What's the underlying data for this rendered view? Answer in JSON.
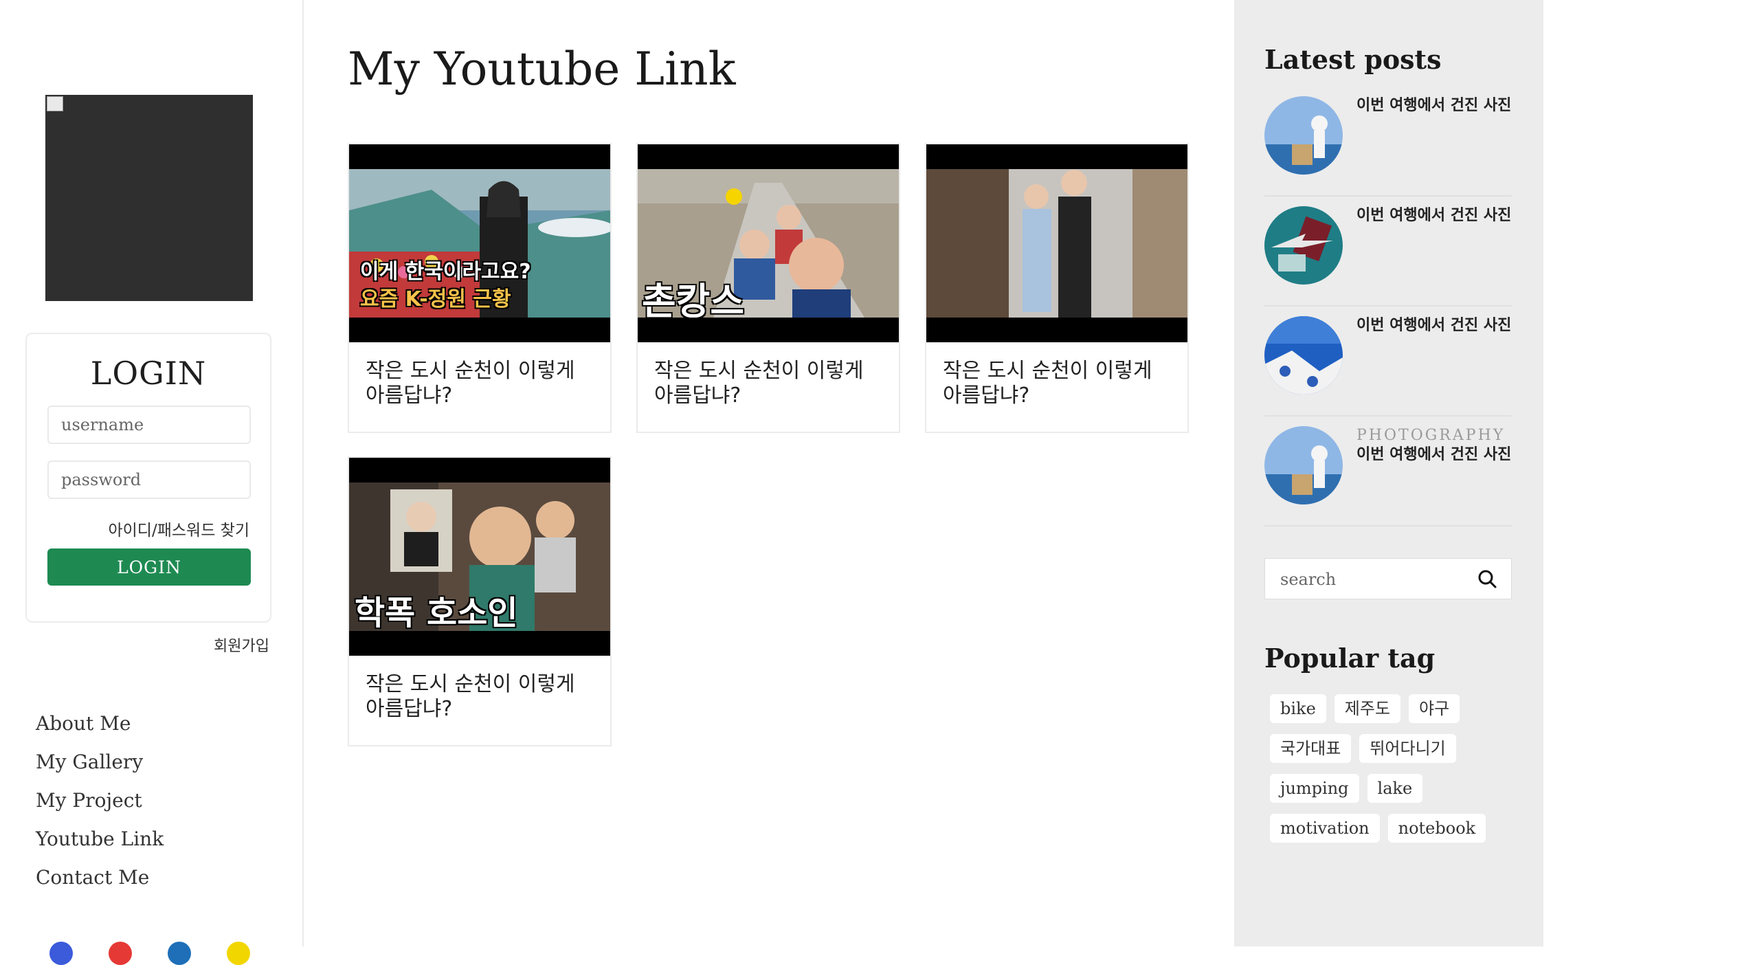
{
  "login": {
    "title": "LOGIN",
    "username_placeholder": "username",
    "password_placeholder": "password",
    "find_link": "아이디/패스워드 찾기",
    "button": "LOGIN",
    "signup": "회원가입"
  },
  "nav": [
    "About Me",
    "My Gallery",
    "My Project",
    "Youtube Link",
    "Contact Me"
  ],
  "social_colors": [
    "#3b5bdb",
    "#e53935",
    "#1e6fb8",
    "#f2d600"
  ],
  "page_title": "My Youtube Link",
  "videos": [
    {
      "title": "작은 도시 순천이 이렇게 아름답냐?",
      "overlay": [
        "이게 한국이라고요?",
        "요즘 K-정원 근황"
      ]
    },
    {
      "title": "작은 도시 순천이 이렇게 아름답냐?",
      "overlay": [
        "촌캉스"
      ]
    },
    {
      "title": "작은 도시 순천이 이렇게 아름답냐?",
      "overlay": []
    },
    {
      "title": "작은 도시 순천이 이렇게 아름답냐?",
      "overlay": [
        "학폭 호소인"
      ]
    }
  ],
  "right": {
    "latest_title": "Latest posts",
    "posts": [
      {
        "category": "",
        "title": "이번 여행에서 건진 사진"
      },
      {
        "category": "",
        "title": "이번 여행에서 건진 사진"
      },
      {
        "category": "",
        "title": "이번 여행에서 건진 사진"
      },
      {
        "category": "PHOTOGRAPHY",
        "title": "이번 여행에서 건진 사진"
      }
    ],
    "search_placeholder": "search",
    "tag_title": "Popular tag",
    "tags": [
      "bike",
      "제주도",
      "야구",
      "국가대표",
      "뛰어다니기",
      "jumping",
      "lake",
      "motivation",
      "notebook"
    ]
  },
  "colors": {
    "accent": "#1e8a52",
    "sidebar_bg": "#ececec"
  }
}
